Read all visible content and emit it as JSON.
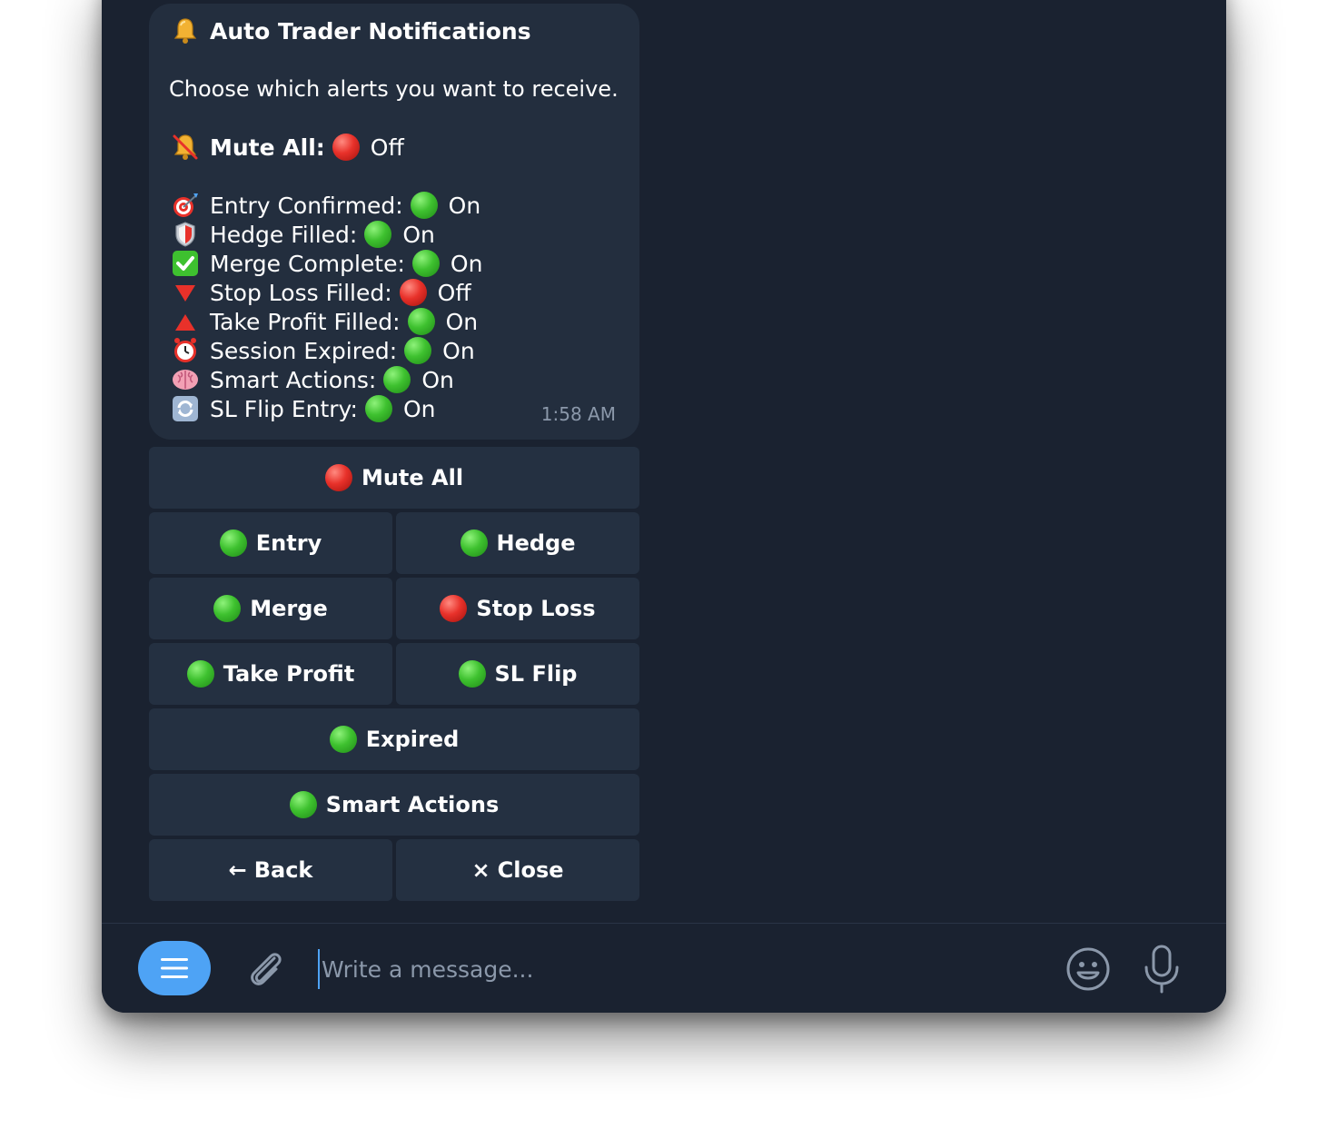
{
  "message": {
    "title": "Auto Trader Notifications",
    "title_icon": "bell-icon",
    "subtitle": "Choose which alerts you want to receive.",
    "mute_all": {
      "icon": "bell-slash-icon",
      "label": "Mute All:",
      "state": "Off",
      "state_color": "red"
    },
    "statuses": [
      {
        "icon": "target-icon",
        "label": "Entry Confirmed:",
        "state": "On",
        "state_color": "green"
      },
      {
        "icon": "shield-icon",
        "label": "Hedge Filled:",
        "state": "On",
        "state_color": "green"
      },
      {
        "icon": "check-box-icon",
        "label": "Merge Complete:",
        "state": "On",
        "state_color": "green"
      },
      {
        "icon": "down-triangle-icon",
        "label": "Stop Loss Filled:",
        "state": "Off",
        "state_color": "red"
      },
      {
        "icon": "up-triangle-icon",
        "label": "Take Profit Filled:",
        "state": "On",
        "state_color": "green"
      },
      {
        "icon": "alarm-clock-icon",
        "label": "Session Expired:",
        "state": "On",
        "state_color": "green"
      },
      {
        "icon": "brain-icon",
        "label": "Smart Actions:",
        "state": "On",
        "state_color": "green"
      },
      {
        "icon": "refresh-icon",
        "label": "SL Flip Entry:",
        "state": "On",
        "state_color": "green"
      }
    ],
    "time": "1:58 AM"
  },
  "keyboard": {
    "mute_all": {
      "label": "Mute All",
      "color": "red"
    },
    "entry": {
      "label": "Entry",
      "color": "green"
    },
    "hedge": {
      "label": "Hedge",
      "color": "green"
    },
    "merge": {
      "label": "Merge",
      "color": "green"
    },
    "stop_loss": {
      "label": "Stop Loss",
      "color": "red"
    },
    "take_profit": {
      "label": "Take Profit",
      "color": "green"
    },
    "sl_flip": {
      "label": "SL Flip",
      "color": "green"
    },
    "expired": {
      "label": "Expired",
      "color": "green"
    },
    "smart_actions": {
      "label": "Smart Actions",
      "color": "green"
    },
    "back": {
      "label": "Back",
      "glyph": "←"
    },
    "close": {
      "label": "Close",
      "glyph": "×"
    }
  },
  "composer": {
    "placeholder": "Write a message...",
    "menu_icon": "menu-icon",
    "attach_icon": "paperclip-icon",
    "emoji_icon": "emoji-icon",
    "mic_icon": "microphone-icon"
  },
  "colors": {
    "background": "#1a2230",
    "bubble": "#232e3e",
    "button": "#243041",
    "accent": "#4ea3f5",
    "muted_text": "#8b98aa"
  }
}
